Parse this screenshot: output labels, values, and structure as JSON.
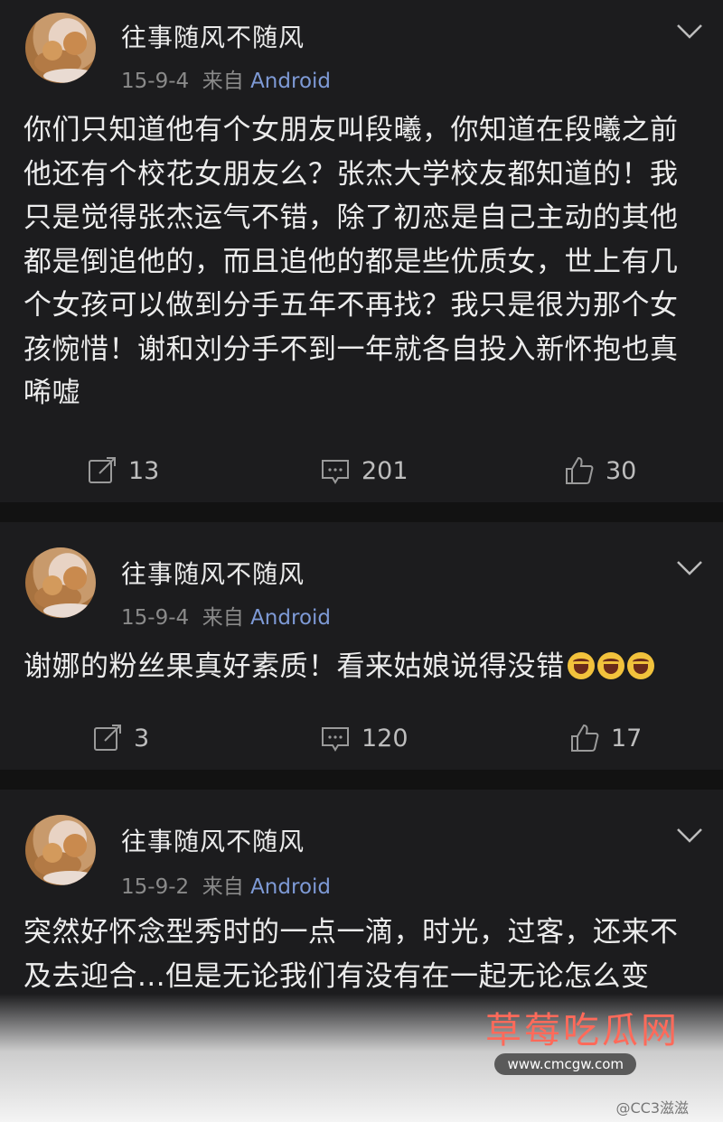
{
  "posts": [
    {
      "user": "往事随风不随风",
      "date": "15-9-4",
      "from": "来自",
      "source": "Android",
      "text": "你们只知道他有个女朋友叫段曦，你知道在段曦之前他还有个校花女朋友么？张杰大学校友都知道的！我只是觉得张杰运气不错，除了初恋是自己主动的其他都是倒追他的，而且追他的都是些优质女，世上有几个女孩可以做到分手五年不再找？我只是很为那个女孩惋惜！谢和刘分手不到一年就各自投入新怀抱也真唏嘘",
      "reposts": "13",
      "comments": "201",
      "likes": "30"
    },
    {
      "user": "往事随风不随风",
      "date": "15-9-4",
      "from": "来自",
      "source": "Android",
      "text": "谢娜的粉丝果真好素质！看来姑娘说得没错",
      "emoji_count": 3,
      "reposts": "3",
      "comments": "120",
      "likes": "17"
    },
    {
      "user": "往事随风不随风",
      "date": "15-9-2",
      "from": "来自",
      "source": "Android",
      "text": "突然好怀念型秀时的一点一滴，时光，过客，还来不及去迎合...但是无论我们有没有在一起无论怎么变"
    }
  ],
  "watermark": {
    "title": "草莓吃瓜网",
    "url": "www.cmcgw.com",
    "credit": "@CC3滋滋"
  },
  "colors": {
    "background": "#1c1c1e",
    "separator": "#121212",
    "source_link": "#7e9ad6",
    "watermark": "#ff6a5a"
  },
  "icons": [
    "avatar-dog",
    "chevron-down-icon",
    "repost-icon",
    "comment-icon",
    "like-icon",
    "laugh-emoji"
  ]
}
